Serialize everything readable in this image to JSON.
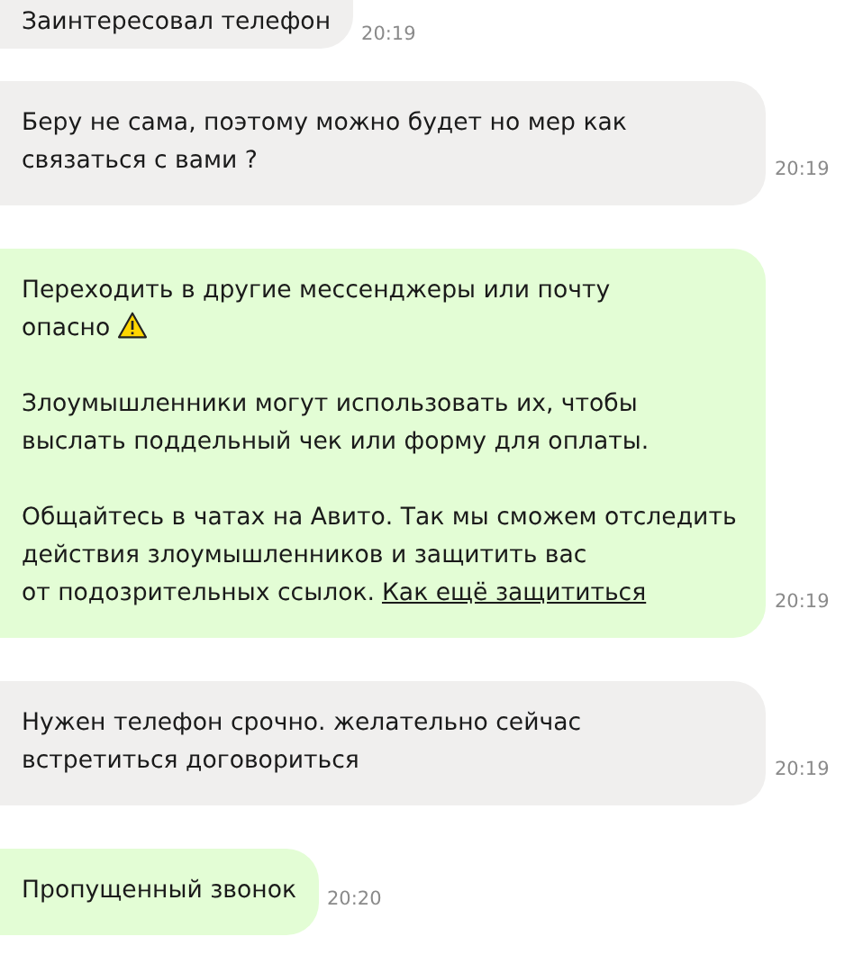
{
  "messages": [
    {
      "kind": "plain",
      "paragraphs": [
        {
          "lines": [
            "Заинтересовал телефон"
          ]
        }
      ],
      "time": "20:19",
      "top_cut": true
    },
    {
      "kind": "plain",
      "paragraphs": [
        {
          "lines": [
            "Беру не сама, поэтому можно будет но мер как",
            "связаться с вами ?"
          ]
        }
      ],
      "time": "20:19"
    },
    {
      "kind": "notice",
      "paragraphs": [
        {
          "lines": [
            "Переходить в другие мессенджеры или почту",
            "опасно"
          ],
          "warning": true
        },
        {
          "lines": [
            "Злоумышленники могут использовать их, чтобы",
            "выслать поддельный чек или форму для оплаты."
          ]
        },
        {
          "lines": [
            "Общайтесь в чатах на Авито. Так мы сможем отследить",
            "действия злоумышленников и защитить вас",
            "от подозрительных ссылок."
          ],
          "link": "Как ещё защититься"
        }
      ],
      "time": "20:19"
    },
    {
      "kind": "plain",
      "paragraphs": [
        {
          "lines": [
            "Нужен телефон срочно. желательно сейчас",
            "встретиться договориться"
          ]
        }
      ],
      "time": "20:19"
    },
    {
      "kind": "notice",
      "paragraphs": [
        {
          "lines": [
            "Пропущенный звонок"
          ]
        }
      ],
      "time": "20:20"
    }
  ]
}
